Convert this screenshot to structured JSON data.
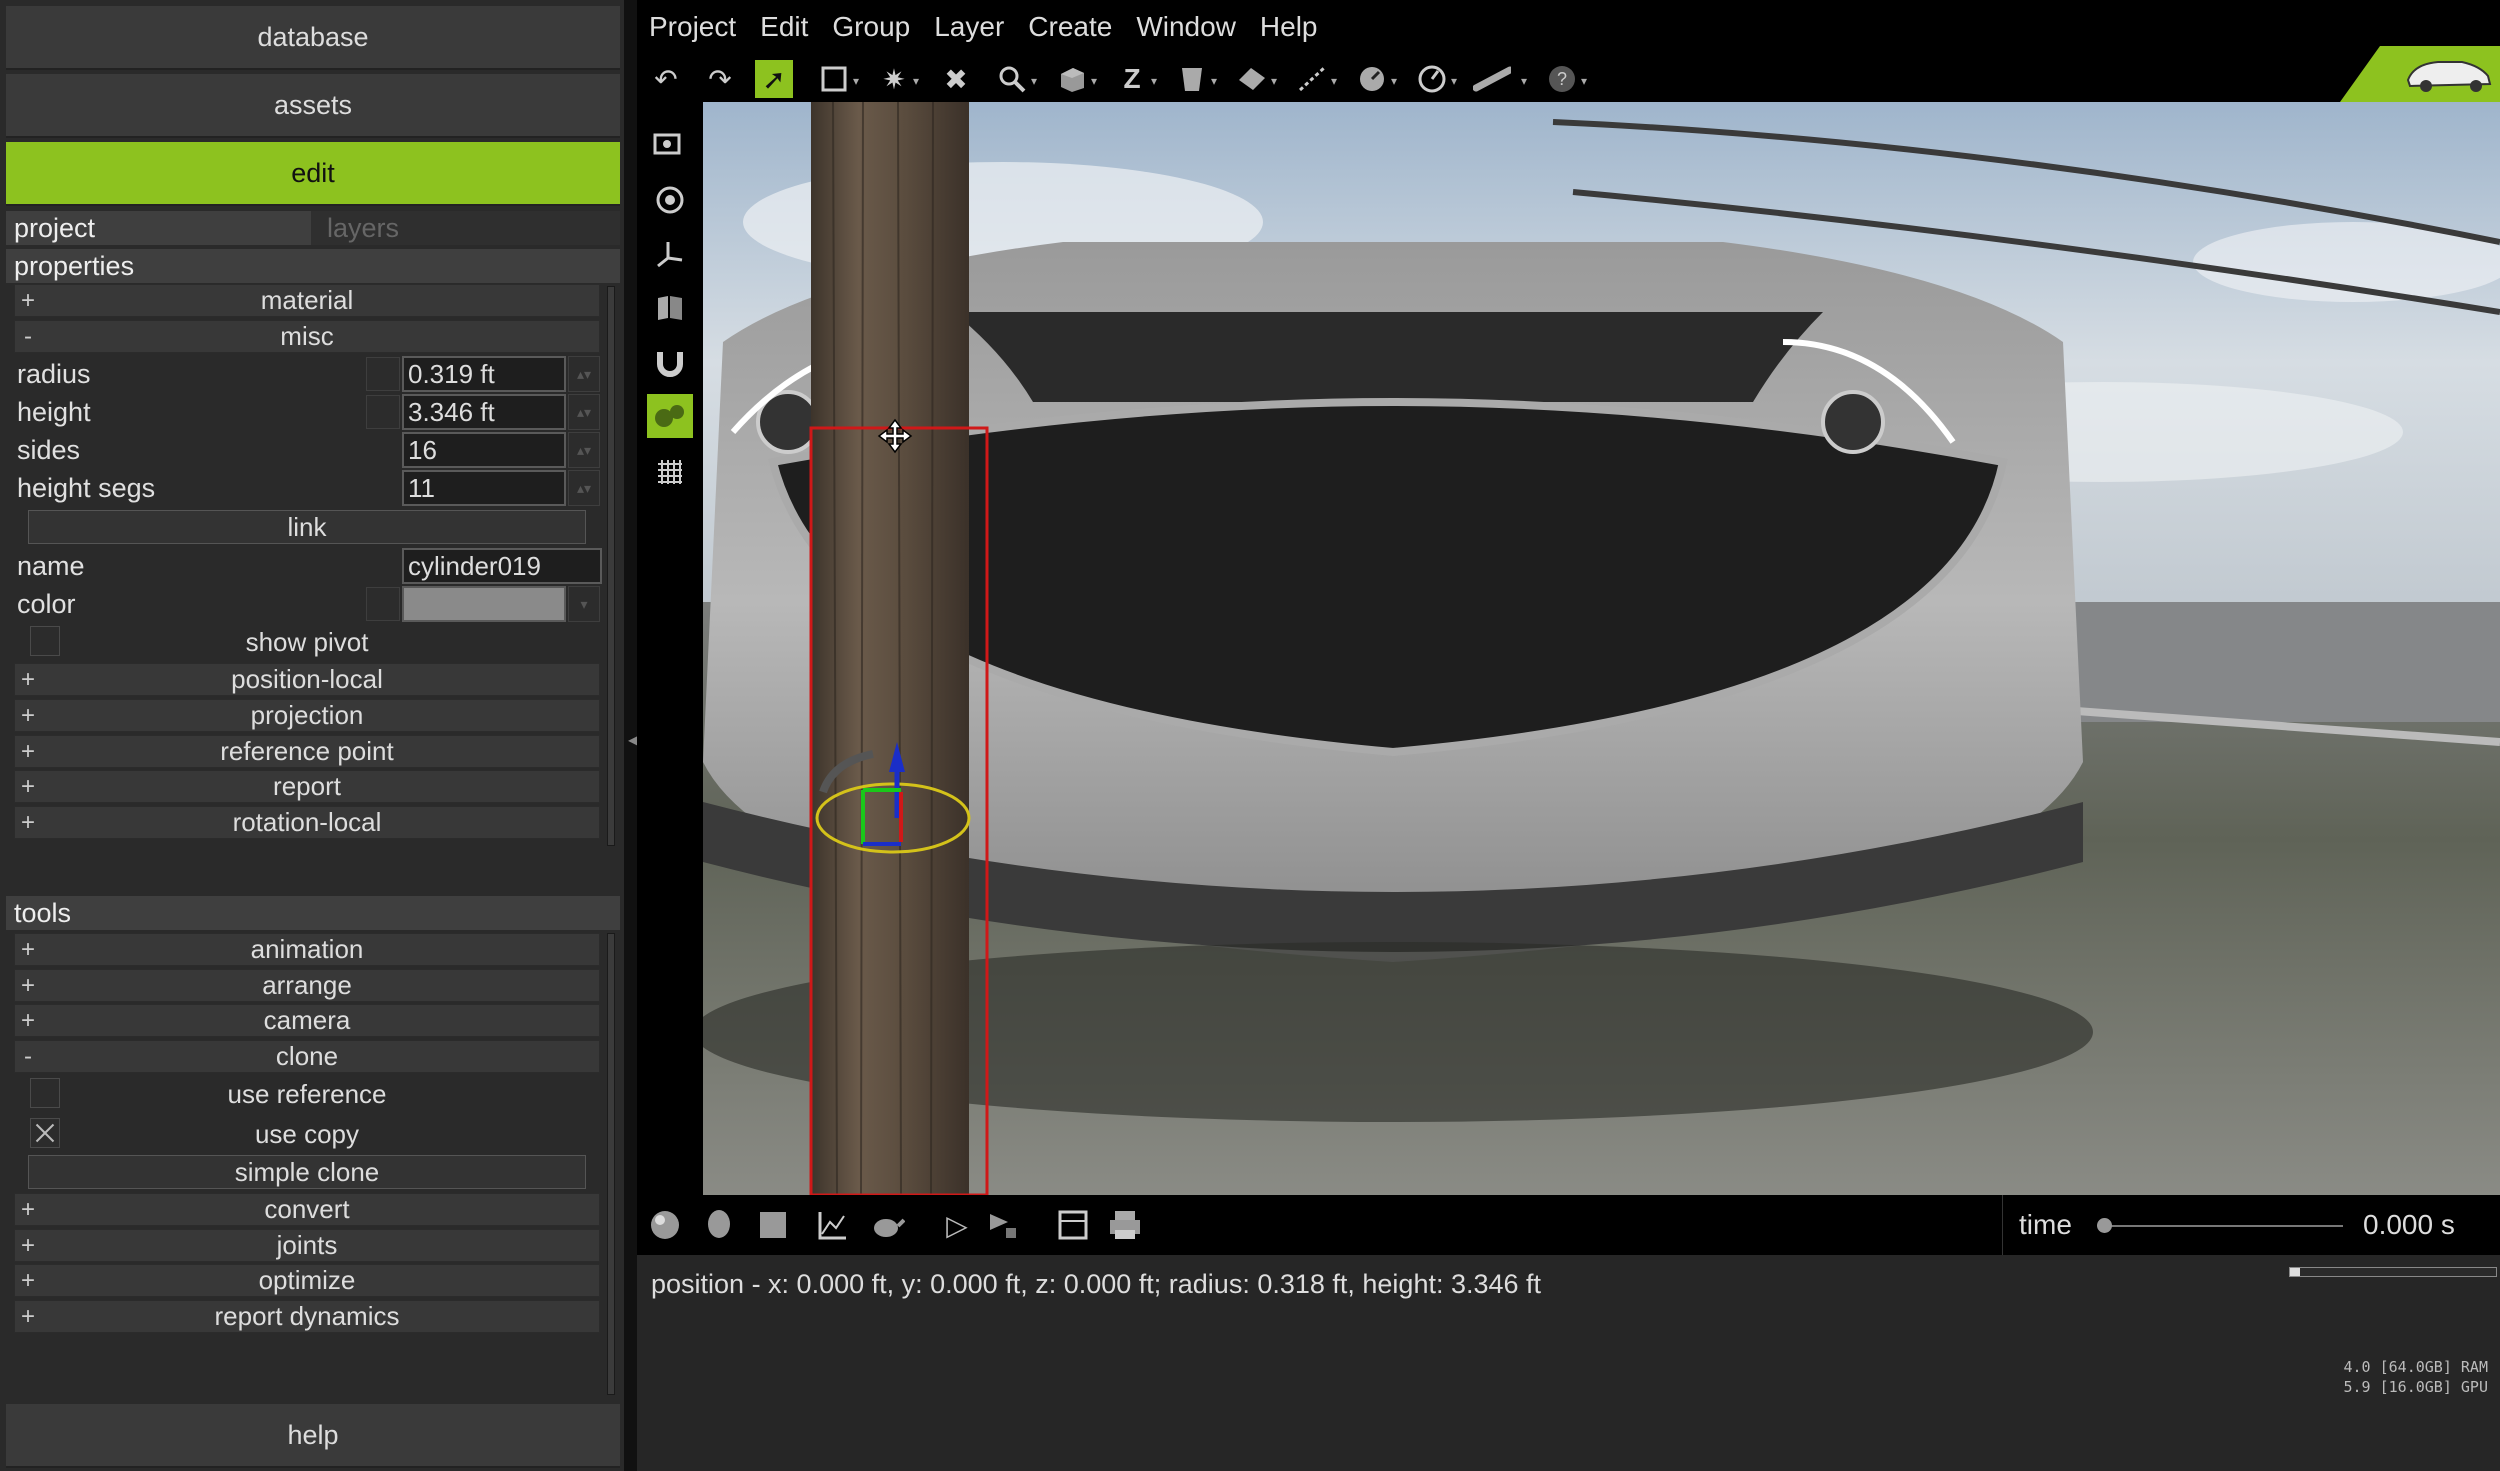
{
  "nav": {
    "database": "database",
    "assets": "assets",
    "edit": "edit",
    "help": "help"
  },
  "tabs": {
    "project": "project",
    "layers": "layers"
  },
  "properties": {
    "title": "properties",
    "groups_top": [
      {
        "sign": "+",
        "label": "material"
      },
      {
        "sign": "-",
        "label": "misc"
      }
    ],
    "fields": [
      {
        "label": "radius",
        "value": "0.319 ft"
      },
      {
        "label": "height",
        "value": "3.346 ft"
      },
      {
        "label": "sides",
        "value": "16"
      },
      {
        "label": "height segs",
        "value": "11"
      }
    ],
    "link_label": "link",
    "name_label": "name",
    "name_value": "cylinder019",
    "color_label": "color",
    "color_value": "#8a8a8a",
    "show_pivot": "show pivot",
    "groups_bottom": [
      {
        "sign": "+",
        "label": "position-local"
      },
      {
        "sign": "+",
        "label": "projection"
      },
      {
        "sign": "+",
        "label": "reference point"
      },
      {
        "sign": "+",
        "label": "report"
      },
      {
        "sign": "+",
        "label": "rotation-local"
      }
    ]
  },
  "tools": {
    "title": "tools",
    "groups_top": [
      {
        "sign": "+",
        "label": "animation"
      },
      {
        "sign": "+",
        "label": "arrange"
      },
      {
        "sign": "+",
        "label": "camera"
      },
      {
        "sign": "-",
        "label": "clone"
      }
    ],
    "use_reference": "use reference",
    "use_copy": "use copy",
    "simple_clone": "simple clone",
    "groups_bottom": [
      {
        "sign": "+",
        "label": "convert"
      },
      {
        "sign": "+",
        "label": "joints"
      },
      {
        "sign": "+",
        "label": "optimize"
      },
      {
        "sign": "+",
        "label": "report dynamics"
      }
    ]
  },
  "menu": [
    "Project",
    "Edit",
    "Group",
    "Layer",
    "Create",
    "Window",
    "Help"
  ],
  "toolbar_icons": [
    "undo-icon",
    "redo-icon",
    "select-arrow-icon",
    "rect-select-icon",
    "explode-icon",
    "delete-icon",
    "zoom-icon",
    "cube-icon",
    "z-axis-icon",
    "bucket-icon",
    "paint-icon",
    "measure-icon",
    "compass-icon",
    "gauge-icon",
    "pipe-icon",
    "help-circle-icon"
  ],
  "side_icons": [
    "camera-view-icon",
    "orbit-icon",
    "axes-icon",
    "map-icon",
    "magnet-icon",
    "gears-icon",
    "grid-icon"
  ],
  "bottom_icons": [
    "sphere-icon",
    "head-icon",
    "square-icon",
    "graph-icon",
    "teapot-icon",
    "play-icon",
    "record-icon",
    "layout-icon",
    "print-icon"
  ],
  "time": {
    "label": "time",
    "value": "0.000 s",
    "position": 0
  },
  "status": "position - x: 0.000 ft, y: 0.000 ft, z: 0.000 ft; radius: 0.318 ft, height: 3.346 ft",
  "progress": 0.05,
  "memory": {
    "ram": "4.0 [64.0GB] RAM",
    "gpu": "5.9 [16.0GB] GPU"
  },
  "colors": {
    "accent": "#8dc21f",
    "selection": "#d01818",
    "gizmo_ring": "#d4c21a"
  }
}
